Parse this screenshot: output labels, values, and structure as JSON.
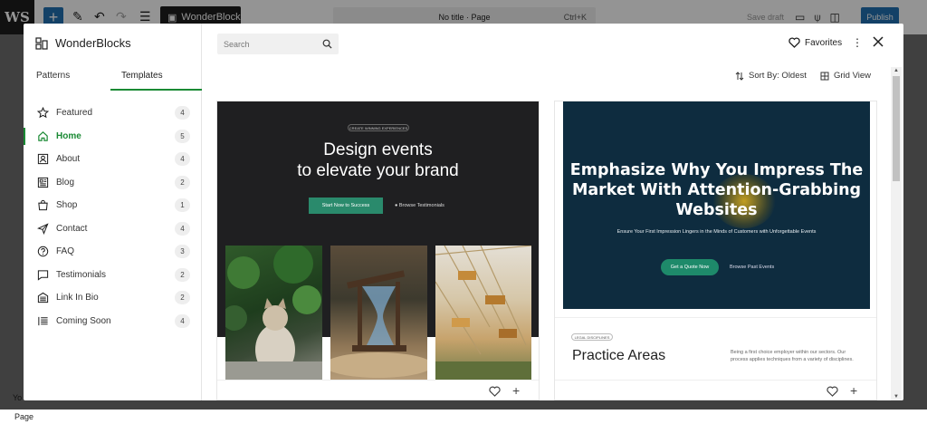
{
  "editor": {
    "logo": "WS",
    "wb_button": "WonderBlocks",
    "doc_title": "No title · Page",
    "doc_shortcut": "Ctrl+K",
    "save_draft": "Save draft",
    "publish": "Publish",
    "side_text": "Yo",
    "bottom_text": "Page"
  },
  "modal": {
    "brand": "WonderBlocks",
    "tabs": [
      "Patterns",
      "Templates"
    ],
    "active_tab": "Templates",
    "search_placeholder": "Search",
    "favorites": "Favorites",
    "sort_label": "Sort By: Oldest",
    "view_label": "Grid View",
    "accent": "#1a8a34",
    "categories": [
      {
        "label": "Featured",
        "count": "4",
        "icon": "star-icon"
      },
      {
        "label": "Home",
        "count": "5",
        "icon": "home-icon",
        "active": true
      },
      {
        "label": "About",
        "count": "4",
        "icon": "person-icon"
      },
      {
        "label": "Blog",
        "count": "2",
        "icon": "document-icon"
      },
      {
        "label": "Shop",
        "count": "1",
        "icon": "shop-icon"
      },
      {
        "label": "Contact",
        "count": "4",
        "icon": "send-icon"
      },
      {
        "label": "FAQ",
        "count": "3",
        "icon": "help-icon"
      },
      {
        "label": "Testimonials",
        "count": "2",
        "icon": "comment-icon"
      },
      {
        "label": "Link In Bio",
        "count": "2",
        "icon": "building-icon"
      },
      {
        "label": "Coming Soon",
        "count": "4",
        "icon": "list-icon"
      }
    ]
  },
  "cards": [
    {
      "badge": "CREATE WINNING EXPERIENCES",
      "title_line1": "Design events",
      "title_line2": "to elevate your brand",
      "button": "Start Now to Success",
      "link": "Browse Testimonials"
    },
    {
      "title": "Emphasize Why You Impress The Market With Attention-Grabbing Websites",
      "subtitle": "Ensure Your First Impression Lingers in the Minds of Customers with Unforgettable Events",
      "button": "Get a Quote Now",
      "link": "Browse Past Events",
      "tag": "LEGAL DISCIPLINES",
      "section_title": "Practice Areas",
      "section_text": "Being a first choice employer within our sectors. Our process applies techniques from a variety of disciplines."
    }
  ]
}
